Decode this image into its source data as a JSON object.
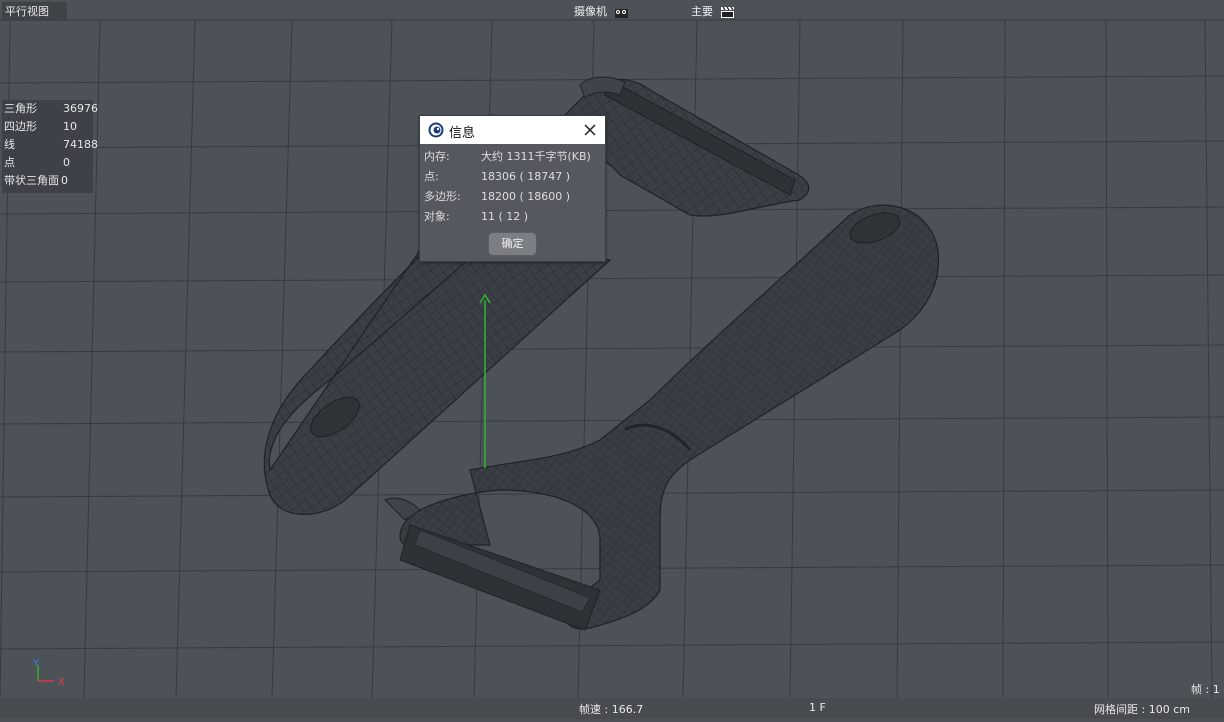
{
  "viewport": {
    "view_label": "平行视图",
    "camera_menu": "摄像机",
    "scene_menu": "主要"
  },
  "stats": {
    "rows": [
      {
        "label": "三角形",
        "value": "36976"
      },
      {
        "label": "四边形",
        "value": "10"
      },
      {
        "label": "线",
        "value": "74188"
      },
      {
        "label": "点",
        "value": "0"
      },
      {
        "label": "带状三角面",
        "value": "0"
      }
    ]
  },
  "dialog": {
    "title": "信息",
    "rows": [
      {
        "label": "内存:",
        "value": "大约 1311千字节(KB)"
      },
      {
        "label": "点:",
        "value": "18306 ( 18747 )"
      },
      {
        "label": "多边形:",
        "value": "18200 ( 18600 )"
      },
      {
        "label": "对象:",
        "value": "11 ( 12 )"
      }
    ],
    "ok_label": "确定"
  },
  "status": {
    "fps": "帧速 : 166.7",
    "frame": "1 F",
    "grid_spacing": "网格间距 : 100 cm",
    "frame_counter": "帧 : 1"
  },
  "axis_labels": {
    "y": "Y",
    "x": "X"
  },
  "colors": {
    "background": "#4d5259",
    "grid_line": "#383c41",
    "mesh_fill": "#3c4046",
    "mesh_line": "#25282c",
    "y_axis": "#2fb52f",
    "x_axis": "#e03a3a"
  }
}
